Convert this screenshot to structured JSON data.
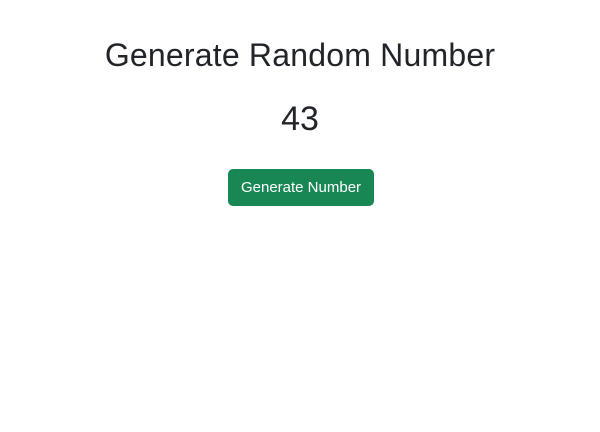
{
  "heading": "Generate Random Number",
  "result": "43",
  "button_label": "Generate Number",
  "colors": {
    "background": "#ffffff",
    "text": "#212529",
    "button": "#198754",
    "button_text": "#ffffff"
  }
}
